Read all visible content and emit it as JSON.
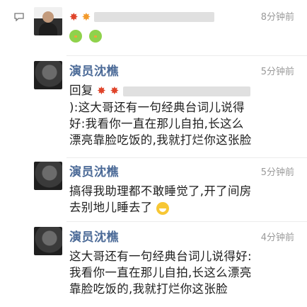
{
  "feed": {
    "items": [
      {
        "name": "",
        "time": "8分钟前",
        "avatar": "person",
        "text_lines": []
      },
      {
        "name": "演员沈樵",
        "time": "5分钟前",
        "avatar": "dark",
        "reply_prefix": "回复",
        "text_lines": [
          "):这大哥还有一句经典台词儿说得",
          "好:我看你一直在那儿自拍,长这么",
          "漂亮靠脸吃饭的,我就打烂你这张脸"
        ]
      },
      {
        "name": "演员沈樵",
        "time": "5分钟前",
        "avatar": "dark",
        "text_lines": [
          "搞得我助理都不敢睡觉了,开了间房",
          "去别地儿睡去了"
        ]
      },
      {
        "name": "演员沈樵",
        "time": "4分钟前",
        "avatar": "dark",
        "text_lines": [
          "这大哥还有一句经典台词儿说得好:",
          "我看你一直在那儿自拍,长这么漂亮",
          "靠脸吃饭的,我就打烂你这张脸"
        ]
      }
    ]
  },
  "icons": {
    "comment": "comment-icon",
    "burst": "explosion-emoji",
    "chick": "chick-emoji",
    "grin": "grin-emoji"
  },
  "colors": {
    "name": "#4b6a97",
    "time": "#9a9a9a",
    "text": "#1e1e1e"
  }
}
